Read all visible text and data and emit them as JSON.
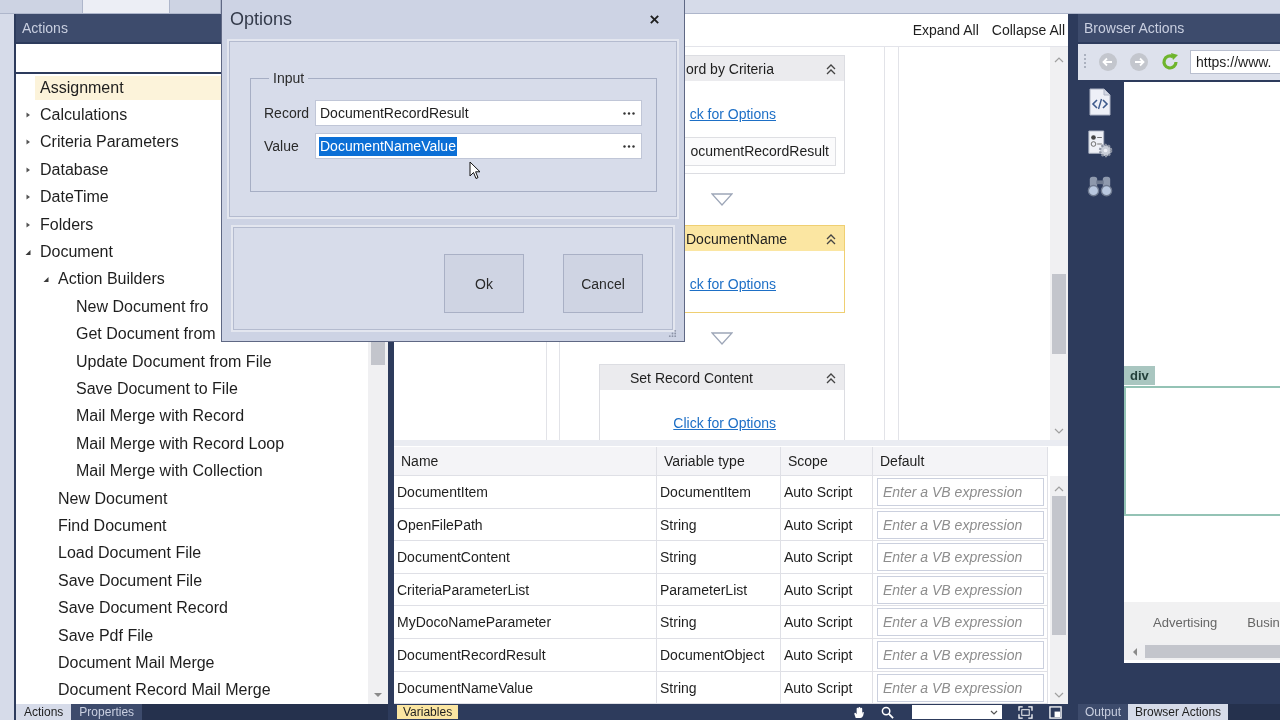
{
  "document_tabs": [
    {
      "selected": false
    },
    {
      "selected": true
    },
    {
      "selected": false
    }
  ],
  "actions_panel": {
    "title": "Actions",
    "tree": [
      {
        "label": "Assignment",
        "kind": "action",
        "selected": true
      },
      {
        "label": "Calculations",
        "kind": "group",
        "expanded": false,
        "selected": false
      },
      {
        "label": "Criteria Parameters",
        "kind": "group",
        "expanded": false,
        "selected": false
      },
      {
        "label": "Database",
        "kind": "group",
        "expanded": false,
        "selected": false
      },
      {
        "label": "DateTime",
        "kind": "group",
        "expanded": false,
        "selected": false
      },
      {
        "label": "Folders",
        "kind": "group",
        "expanded": false,
        "selected": false
      },
      {
        "label": "Document",
        "kind": "group",
        "expanded": true,
        "selected": false,
        "children": [
          {
            "label": "Action Builders",
            "kind": "group",
            "expanded": true,
            "selected": false,
            "children": [
              {
                "label": "New Document fro",
                "kind": "action",
                "selected": false
              },
              {
                "label": "Get Document from",
                "kind": "action",
                "selected": false
              },
              {
                "label": "Update Document from File",
                "kind": "action",
                "selected": false
              },
              {
                "label": "Save Document to File",
                "kind": "action",
                "selected": false
              },
              {
                "label": "Mail Merge with Record",
                "kind": "action",
                "selected": false
              },
              {
                "label": "Mail Merge with Record Loop",
                "kind": "action",
                "selected": false
              },
              {
                "label": "Mail Merge with Collection",
                "kind": "action",
                "selected": false
              }
            ]
          },
          {
            "label": "New Document",
            "kind": "action",
            "selected": false
          },
          {
            "label": "Find Document",
            "kind": "action",
            "selected": false
          },
          {
            "label": "Load Document File",
            "kind": "action",
            "selected": false
          },
          {
            "label": "Save Document File",
            "kind": "action",
            "selected": false
          },
          {
            "label": "Save Document Record",
            "kind": "action",
            "selected": false
          },
          {
            "label": "Save Pdf File",
            "kind": "action",
            "selected": false
          },
          {
            "label": "Document Mail Merge",
            "kind": "action",
            "selected": false
          },
          {
            "label": "Document Record Mail Merge",
            "kind": "action",
            "selected": false
          }
        ]
      }
    ],
    "tabs": [
      {
        "label": "Actions",
        "selected": true
      },
      {
        "label": "Properties",
        "selected": false
      }
    ]
  },
  "dialog": {
    "title": "Options",
    "group_label": "Input",
    "fields": [
      {
        "label": "Record",
        "value": "DocumentRecordResult",
        "text_selected": false
      },
      {
        "label": "Value",
        "value": "DocumentNameValue",
        "text_selected": true
      }
    ],
    "buttons": [
      "Ok",
      "Cancel"
    ]
  },
  "designer": {
    "toolbar": [
      "Expand All",
      "Collapse All"
    ],
    "activities": [
      {
        "title": "ord by Criteria",
        "link": "ck for Options",
        "result": "ocumentRecordResult",
        "selected": false
      },
      {
        "title": "DocumentName",
        "link": "ck for Options",
        "selected": true
      },
      {
        "title": "Set Record Content",
        "link": "Click for Options",
        "selected": false
      }
    ]
  },
  "variables": {
    "columns": [
      "Name",
      "Variable type",
      "Scope",
      "Default"
    ],
    "rows": [
      {
        "name": "DocumentItem",
        "type": "DocumentItem",
        "scope": "Auto Script",
        "default": {
          "placeholder": "Enter a VB expression"
        }
      },
      {
        "name": "OpenFilePath",
        "type": "String",
        "scope": "Auto Script",
        "default": {
          "placeholder": "Enter a VB expression"
        }
      },
      {
        "name": "DocumentContent",
        "type": "String",
        "scope": "Auto Script",
        "default": {
          "placeholder": "Enter a VB expression"
        }
      },
      {
        "name": "CriteriaParameterList",
        "type": "ParameterList",
        "scope": "Auto Script",
        "default": {
          "placeholder": "Enter a VB expression"
        }
      },
      {
        "name": "MyDocoNameParameter",
        "type": "String",
        "scope": "Auto Script",
        "default": {
          "placeholder": "Enter a VB expression"
        }
      },
      {
        "name": "DocumentRecordResult",
        "type": "DocumentObject",
        "scope": "Auto Script",
        "default": {
          "placeholder": "Enter a VB expression"
        }
      },
      {
        "name": "DocumentNameValue",
        "type": "String",
        "scope": "Auto Script",
        "default": {
          "placeholder": "Enter a VB expression"
        }
      }
    ],
    "tabs": [
      {
        "label": "Variables",
        "selected": true
      }
    ]
  },
  "browser_panel": {
    "title": "Browser Actions",
    "nav_buttons": [
      {
        "kind": "back",
        "disabled": true
      },
      {
        "kind": "forward",
        "disabled": true
      },
      {
        "kind": "refresh",
        "disabled": false
      }
    ],
    "url": "https://www.",
    "element_tag": "div",
    "footer_links": [
      "Advertising",
      "Busin"
    ],
    "tabs": [
      {
        "label": "Output",
        "selected": false
      },
      {
        "label": "Browser Actions",
        "selected": true
      }
    ]
  }
}
